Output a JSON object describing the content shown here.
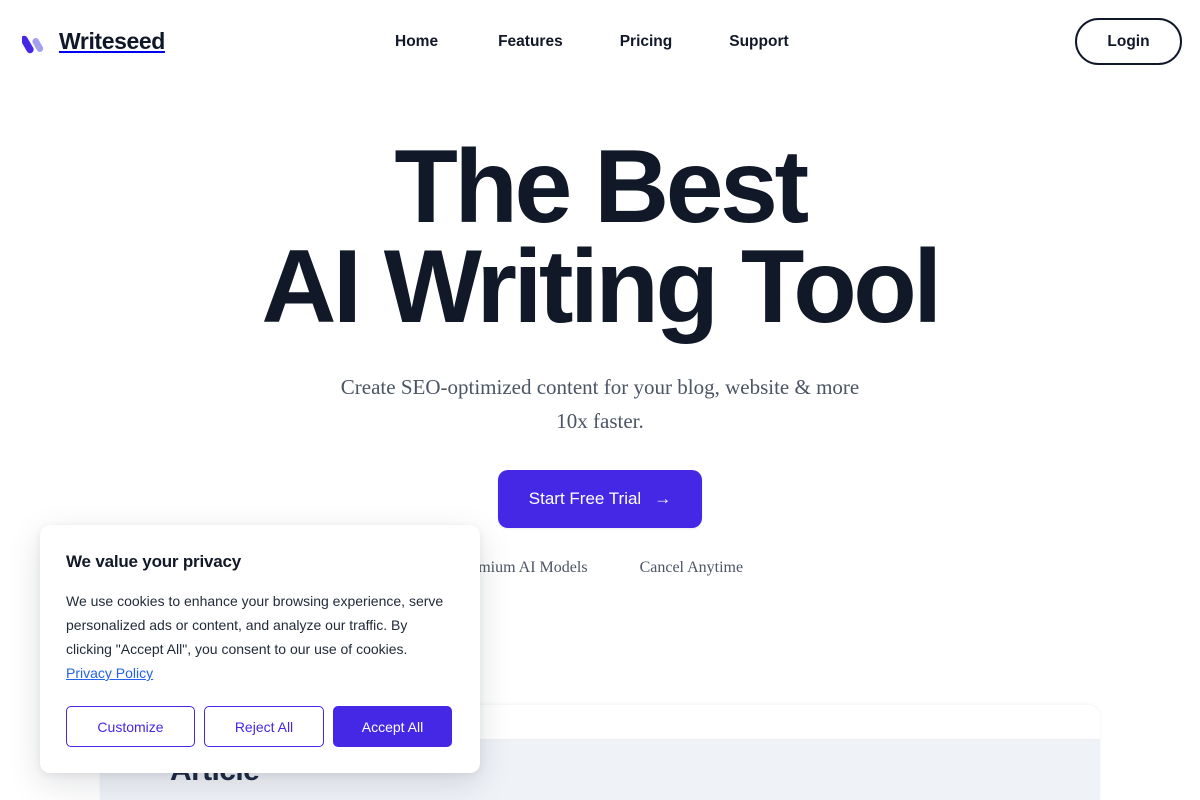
{
  "brand": {
    "name": "Writeseed",
    "logo_icon": "double-slash-logo-icon",
    "logo_color_primary": "#4428e6",
    "logo_color_secondary": "#a5a0ee"
  },
  "nav": {
    "items": [
      {
        "label": "Home"
      },
      {
        "label": "Features"
      },
      {
        "label": "Pricing"
      },
      {
        "label": "Support"
      }
    ],
    "login_label": "Login"
  },
  "hero": {
    "title_line1": "The Best",
    "title_line2": "AI Writing Tool",
    "subtitle_line1": "Create SEO-optimized content for your blog, website &",
    "subtitle_line2": "more 10x faster.",
    "cta_label": "Start Free Trial",
    "cta_arrow": "→",
    "cta_color": "#4428e6",
    "trust_items": [
      {
        "label": "Premium AI Models"
      },
      {
        "label": "Cancel Anytime"
      }
    ]
  },
  "preview": {
    "heading": "Article",
    "window_dots": [
      "dot-1",
      "dot-2",
      "dot-3"
    ]
  },
  "cookie_banner": {
    "title": "We value your privacy",
    "body": "We use cookies to enhance your browsing experience, serve personalized ads or content, and analyze our traffic. By clicking \"Accept All\", you consent to our use of cookies.",
    "link_label": "Privacy Policy",
    "link_color": "#2563eb",
    "buttons": {
      "customize": "Customize",
      "reject": "Reject All",
      "accept": "Accept All"
    },
    "accent_color": "#4428e6"
  }
}
